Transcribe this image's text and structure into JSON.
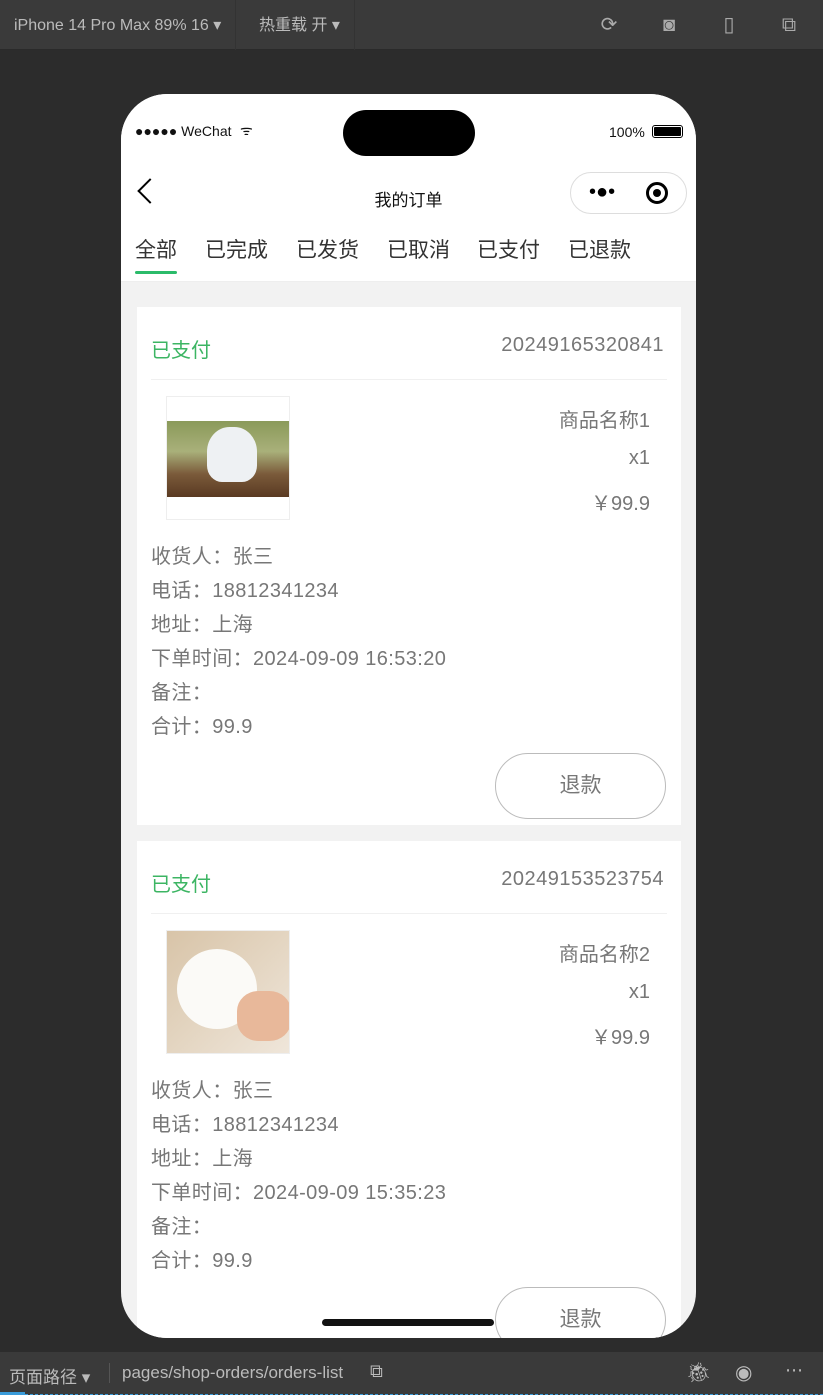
{
  "devtools": {
    "device": "iPhone 14 Pro Max 89% 16 ▾",
    "hot_reload": "热重载 开 ▾",
    "path_label": "页面路径 ▾",
    "path": "pages/shop-orders/orders-list"
  },
  "status": {
    "carrier": "●●●●● WeChat",
    "battery": "100%"
  },
  "nav": {
    "title": "我的订单",
    "menu": "•●•"
  },
  "tabs": [
    {
      "label": "全部"
    },
    {
      "label": "已完成"
    },
    {
      "label": "已发货"
    },
    {
      "label": "已取消"
    },
    {
      "label": "已支付"
    },
    {
      "label": "已退款"
    }
  ],
  "orders": [
    {
      "status": "已支付",
      "order_no": "20249165320841",
      "name": "商品名称1",
      "qty": "x1",
      "price": "￥99.9",
      "receiver": "收货人：张三",
      "phone": "电话：18812341234",
      "address": "地址：上海",
      "time": "下单时间：2024-09-09 16:53:20",
      "remark": "备注：",
      "total": "合计：99.9",
      "button": "退款"
    },
    {
      "status": "已支付",
      "order_no": "20249153523754",
      "name": "商品名称2",
      "qty": "x1",
      "price": "￥99.9",
      "receiver": "收货人：张三",
      "phone": "电话：18812341234",
      "address": "地址：上海",
      "time": "下单时间：2024-09-09 15:35:23",
      "remark": "备注：",
      "total": "合计：99.9",
      "button": "退款"
    }
  ]
}
